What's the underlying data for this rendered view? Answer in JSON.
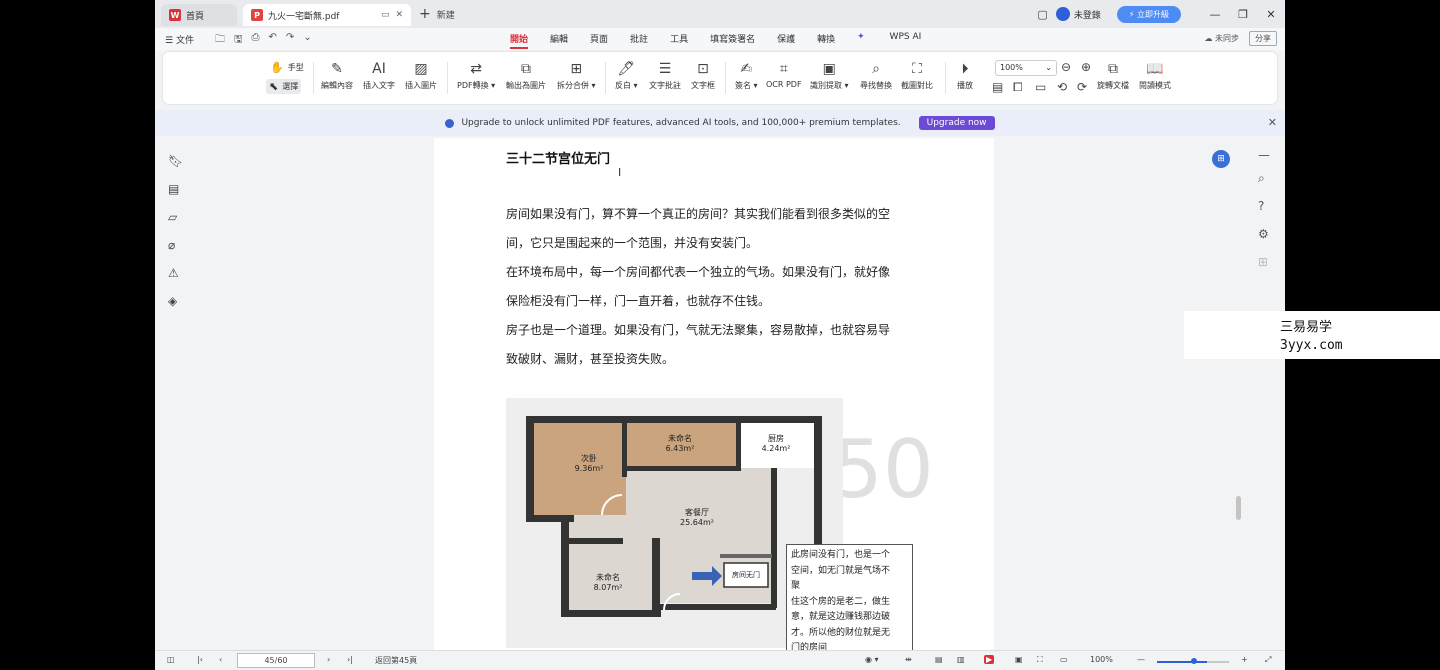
{
  "titlebar": {
    "home_tab": "首頁",
    "doc_tab": "九火一宅斷無.pdf",
    "new_tab": "新建",
    "user": "未登錄",
    "upgrade": "立即升級"
  },
  "menubar": {
    "file": "文件",
    "tabs": [
      "開始",
      "編輯",
      "頁面",
      "批註",
      "工具",
      "填寫簽署名",
      "保護",
      "轉換",
      "WPS AI"
    ],
    "sync": "未同步",
    "share": "分享"
  },
  "ribbon": {
    "hand": "手型",
    "select": "選擇",
    "buttons": [
      "編輯內容",
      "插入文字",
      "插入圖片",
      "PDF轉換",
      "輸出為圖片",
      "拆分合併",
      "反白",
      "文字批註",
      "文字框",
      "簽名",
      "OCR PDF",
      "識別提取",
      "尋找替換",
      "截圖對比",
      "播放",
      "旋轉文檔",
      "閱讀模式"
    ],
    "zoom": "100%"
  },
  "promo": {
    "text": "Upgrade to unlock unlimited PDF features, advanced AI tools, and 100,000+ premium templates.",
    "button": "Upgrade now"
  },
  "page": {
    "title": "三十二节宫位无门",
    "lines": [
      "房间如果没有门，算不算一个真正的房间？其实我们能看到很多类似的空",
      "间，它只是围起来的一个范围，并没有安装门。",
      "在环境布局中，每一个房间都代表一个独立的气场。如果没有门，就好像",
      "保险柜没有门一样，门一直开着，也就存不住钱。",
      "房子也是一个道理。如果没有门，气就无法聚集，容易散掉，也就容易导",
      "致破财、漏财，甚至投资失败。"
    ],
    "watermark": "50"
  },
  "floorplan": {
    "rooms": [
      {
        "name": "次卧",
        "area": "9.36m²"
      },
      {
        "name": "未命名",
        "area": "6.43m²"
      },
      {
        "name": "厨房",
        "area": "4.24m²"
      },
      {
        "name": "客餐厅",
        "area": "25.64m²"
      },
      {
        "name": "未命名",
        "area": "8.07m²"
      }
    ],
    "door_label": "房间无门",
    "colors": {
      "wall": "#333333",
      "wood": "#c9a47e",
      "floor": "#dcd8d1",
      "arrow": "#3a63b8"
    }
  },
  "note": {
    "lines": [
      "此房间没有门，也是一个",
      "空间，如无门就是气场不",
      "聚",
      "住这个房的是老二，做生",
      "意，就是这边赚钱那边破",
      "才。所以他的财位就是无",
      "门的房间"
    ]
  },
  "statusbar": {
    "page": "45/60",
    "back": "返回第45頁",
    "zoom": "100%"
  },
  "site": {
    "name": "三易易学",
    "url": "3yyx.com"
  }
}
